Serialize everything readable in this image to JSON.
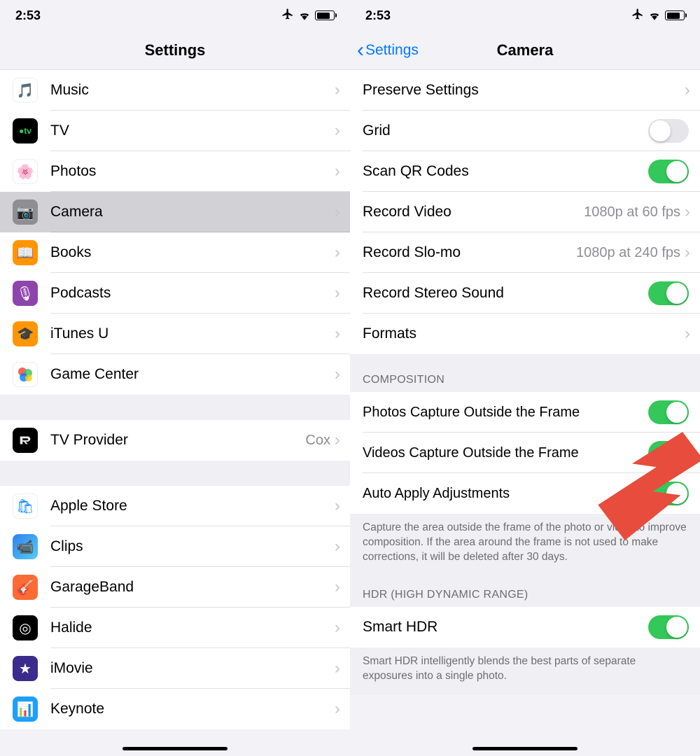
{
  "status": {
    "time": "2:53"
  },
  "left": {
    "title": "Settings",
    "items": [
      {
        "label": "Music",
        "icon": "music",
        "bg": "#fff"
      },
      {
        "label": "TV",
        "icon": "tv",
        "bg": "#000"
      },
      {
        "label": "Photos",
        "icon": "photos",
        "bg": "#fff"
      },
      {
        "label": "Camera",
        "icon": "camera",
        "bg": "#9e9e9e",
        "selected": true
      },
      {
        "label": "Books",
        "icon": "books",
        "bg": "#ff9500"
      },
      {
        "label": "Podcasts",
        "icon": "podcasts",
        "bg": "#8e44ad"
      },
      {
        "label": "iTunes U",
        "icon": "itunesu",
        "bg": "#ff9500"
      },
      {
        "label": "Game Center",
        "icon": "gamecenter",
        "bg": "#fff"
      }
    ],
    "group2": [
      {
        "label": "TV Provider",
        "icon": "tvprovider",
        "bg": "#000",
        "value": "Cox"
      }
    ],
    "group3": [
      {
        "label": "Apple Store",
        "icon": "applestore",
        "bg": "#fff"
      },
      {
        "label": "Clips",
        "icon": "clips",
        "bg": "#fff"
      },
      {
        "label": "GarageBand",
        "icon": "garageband",
        "bg": "#ffb347"
      },
      {
        "label": "Halide",
        "icon": "halide",
        "bg": "#000"
      },
      {
        "label": "iMovie",
        "icon": "imovie",
        "bg": "#3b2b8c"
      },
      {
        "label": "Keynote",
        "icon": "keynote",
        "bg": "#1ca0ff"
      }
    ]
  },
  "right": {
    "back": "Settings",
    "title": "Camera",
    "main": [
      {
        "type": "link",
        "label": "Preserve Settings"
      },
      {
        "type": "toggle",
        "label": "Grid",
        "on": false
      },
      {
        "type": "toggle",
        "label": "Scan QR Codes",
        "on": true
      },
      {
        "type": "link",
        "label": "Record Video",
        "value": "1080p at 60 fps"
      },
      {
        "type": "link",
        "label": "Record Slo-mo",
        "value": "1080p at 240 fps"
      },
      {
        "type": "toggle",
        "label": "Record Stereo Sound",
        "on": true
      },
      {
        "type": "link",
        "label": "Formats"
      }
    ],
    "composition_header": "COMPOSITION",
    "composition": [
      {
        "label": "Photos Capture Outside the Frame",
        "on": true
      },
      {
        "label": "Videos Capture Outside the Frame",
        "on": true
      },
      {
        "label": "Auto Apply Adjustments",
        "on": true
      }
    ],
    "composition_footer": "Capture the area outside the frame of the photo or video to improve composition. If the area around the frame is not used to make corrections, it will be deleted after 30 days.",
    "hdr_header": "HDR (HIGH DYNAMIC RANGE)",
    "hdr": [
      {
        "label": "Smart HDR",
        "on": true
      }
    ],
    "hdr_footer": "Smart HDR intelligently blends the best parts of separate exposures into a single photo."
  }
}
